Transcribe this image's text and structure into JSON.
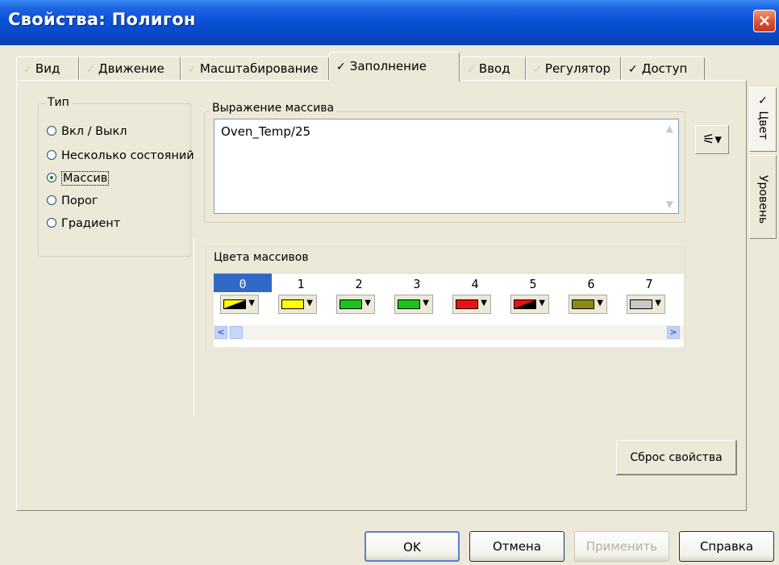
{
  "window": {
    "title": "Свойства: Полигон",
    "close_icon": "×"
  },
  "tabs": [
    {
      "label": "Вид",
      "checked": false
    },
    {
      "label": "Движение",
      "checked": false
    },
    {
      "label": "Масштабирование",
      "checked": false
    },
    {
      "label": "Заполнение",
      "checked": true,
      "active": true
    },
    {
      "label": "Ввод",
      "checked": false
    },
    {
      "label": "Регулятор",
      "checked": false
    },
    {
      "label": "Доступ",
      "checked": true
    }
  ],
  "side_tabs": [
    {
      "label": "Цвет",
      "checked": true,
      "active": true
    },
    {
      "label": "Уровень",
      "checked": false
    }
  ],
  "type_group": {
    "title": "Тип",
    "options": [
      {
        "label": "Вкл / Выкл",
        "selected": false
      },
      {
        "label": "Несколько состояний",
        "selected": false
      },
      {
        "label": "Массив",
        "selected": true
      },
      {
        "label": "Порог",
        "selected": false
      },
      {
        "label": "Градиент",
        "selected": false
      }
    ]
  },
  "array_expression": {
    "title": "Выражение массива",
    "value": "Oven_Temp/25"
  },
  "array_colors": {
    "title": "Цвета массивов",
    "selected_index": 0,
    "cells": [
      {
        "index": "0",
        "fill": "#ffff00",
        "split": "#000000"
      },
      {
        "index": "1",
        "fill": "#ffff00",
        "split": ""
      },
      {
        "index": "2",
        "fill": "#1bc41b",
        "split": ""
      },
      {
        "index": "3",
        "fill": "#1bc41b",
        "split": ""
      },
      {
        "index": "4",
        "fill": "#ee1111",
        "split": ""
      },
      {
        "index": "5",
        "fill": "#ee1111",
        "split": "#000000"
      },
      {
        "index": "6",
        "fill": "#8a8a10",
        "split": ""
      },
      {
        "index": "7",
        "fill": "#c8c8c8",
        "split": ""
      }
    ]
  },
  "reset_button": "Сброс свойства",
  "footer": {
    "ok": "OK",
    "cancel": "Отмена",
    "apply": "Применить",
    "help": "Справка"
  }
}
